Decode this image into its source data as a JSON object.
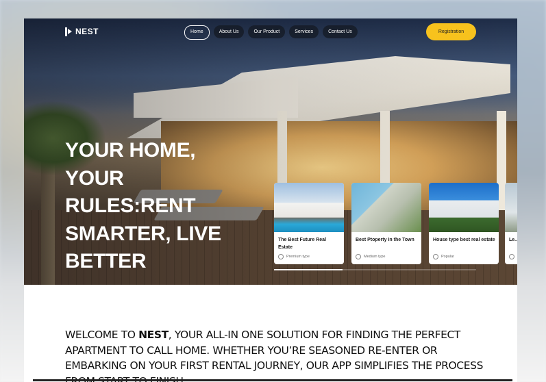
{
  "brand": {
    "name": "NEST"
  },
  "nav": {
    "items": [
      {
        "label": "Home",
        "active": true
      },
      {
        "label": "About Us",
        "active": false
      },
      {
        "label": "Our Product",
        "active": false
      },
      {
        "label": "Services",
        "active": false
      },
      {
        "label": "Contact Us",
        "active": false
      }
    ],
    "cta": "Registration"
  },
  "hero": {
    "headline_lines": [
      "YOUR HOME,",
      "YOUR",
      "RULES:RENT",
      "SMARTER, LIVE",
      "BETTER"
    ],
    "carousel_progress": 0.34
  },
  "cards": [
    {
      "title": "The Best Future Real Estate",
      "tag": "Premium type"
    },
    {
      "title": "Best Ptoperty in the Town",
      "tag": "Medium type"
    },
    {
      "title": "House type best real estate",
      "tag": "Popular"
    },
    {
      "title": "Le... Be...",
      "tag": ""
    }
  ],
  "welcome": {
    "prefix": "WELCOME TO ",
    "brand": "NEST",
    "text": ", YOUR  ALL-IN ONE SOLUTION FOR FINDING THE PERFECT APARTMENT TO CALL HOME. WHETHER YOU’RE SEASONED RE-ENTER OR EMBARKING ON YOUR FIRST RENTAL JOURNEY, OUR APP SIMPLIFIES THE PROCESS FROM START TO FINISH."
  },
  "colors": {
    "accent": "#f7c21d",
    "text": "#111111",
    "white": "#ffffff"
  }
}
